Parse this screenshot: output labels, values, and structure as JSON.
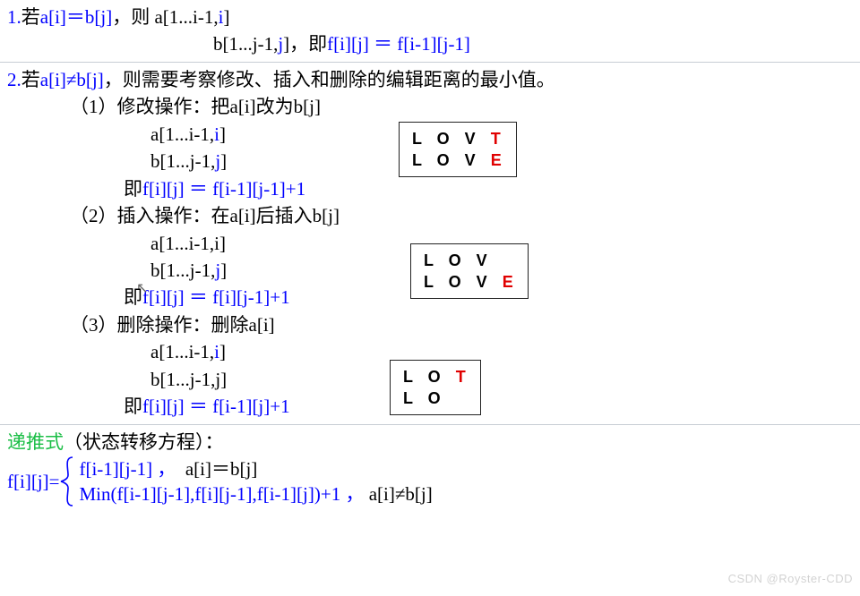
{
  "sec1": {
    "l1a": "1.",
    "l1b": "若",
    "l1c": "a[i]＝b[j]",
    "l1d": "，则 a[1...i-1,",
    "l1e": "i",
    "l1f": "]",
    "l2a": "b[1...j-1,",
    "l2b": "j",
    "l2c": "]，即",
    "l2d": "f[i][j] ＝ f[i-1][j-1]"
  },
  "sec2": {
    "h1a": "2.",
    "h1b": "若",
    "h1c": "a[i]≠b[j]",
    "h1d": "，则需要考察修改、插入和删除的编辑距离的最小值。",
    "op1": {
      "t": "（1）修改操作：把a[i]改为b[j]",
      "a1": "a[1...i-1,",
      "a1r": "i",
      "a1e": "]",
      "b1": "b[1...j-1,",
      "b1r": "j",
      "b1e": "]",
      "f": "即",
      "fe": "f[i][j] ＝ f[i-1][j-1]+1",
      "box_l1a": "L O V ",
      "box_l1b": "T",
      "box_l2a": "L O V ",
      "box_l2b": "E"
    },
    "op2": {
      "t": "（2）插入操作：在a[i]后插入b[j]",
      "a1": "a[1...i-1,i]",
      "b1": "b[1...j-1,",
      "b1r": "j",
      "b1e": "]",
      "f": "即",
      "fe": "f[i][j] ＝ f[i][j-1]+1",
      "box_l1": "L O V",
      "box_l2a": "L O V ",
      "box_l2b": "E"
    },
    "op3": {
      "t": "（3）删除操作：删除a[i]",
      "a1": "a[1...i-1,",
      "a1r": "i",
      "a1e": "]",
      "b1": "b[1...j-1,j]",
      "f": "即",
      "fe": "f[i][j] ＝ f[i-1][j]+1",
      "box_l1a": "L O ",
      "box_l1b": "T",
      "box_l2": "L O"
    }
  },
  "sec3": {
    "title1": "递推式",
    "title2": "（状态转移方程）：",
    "lhs": "f[i][j]=",
    "c1a": "f[i-1][j-1] ，  ",
    "c1b": "a[i]＝b[j]",
    "c2a": "Min(f[i-1][j-1],f[i][j-1],f[i-1][j])+1 ， ",
    "c2b": "a[i]≠b[j]"
  },
  "cursor": "↖",
  "watermark": "CSDN @Royster-CDD"
}
